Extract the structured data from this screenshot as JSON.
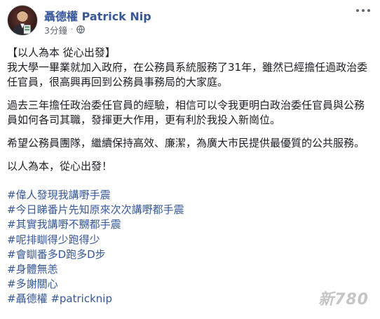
{
  "post": {
    "author": "聶德權 Patrick Nip",
    "time": "3分鐘",
    "separator": "·",
    "icons": {
      "avatar": "profile-photo",
      "privacy": "globe-icon",
      "menu": "more-options-icon"
    },
    "colors": {
      "author": "#385898",
      "hashtag": "#365899",
      "text": "#1c1e21",
      "meta": "#616770"
    },
    "paragraphs": [
      "【以人為本 從心出發】",
      "我大學一畢業就加入政府，在公務員系統服務了31年，雖然已經擔任過政治委任官員，很高興再回到公務員事務局的大家庭。",
      "過去三年擔任政治委任官員的經驗，相信可以令我更明白政治委任官員與公務員如何各司其職，發揮更大作用，更有利於我投入新崗位。",
      "希望公務員團隊，繼續保持高效、廉潔，為廣大市民提供最優質的公共服務。",
      "以人為本，從心出發！"
    ],
    "hashtags": [
      "#偉人發現我講嘢手震",
      "#今日睇番片先知原來次次講嘢都手震",
      "#其實我講嘢不嬲都手震",
      "#呢排瞓得少跑得少",
      "#會瞓番多D跑多D步",
      "#身體無恙",
      "#多謝關心",
      "#聶德權 #patricknip"
    ]
  },
  "watermark": "新780"
}
